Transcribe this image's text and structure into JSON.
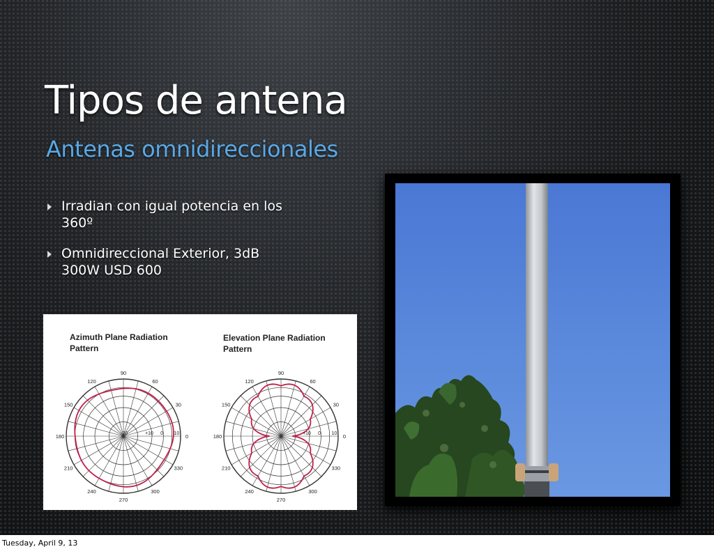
{
  "slide": {
    "title": "Tipos de antena",
    "subtitle": "Antenas omnidireccionales",
    "bullets": [
      {
        "line1": "Irradian con igual potencia en los",
        "line2": "360º"
      },
      {
        "line1": "Omnidireccional Exterior,  3dB",
        "line2": "300W USD 600"
      }
    ]
  },
  "patterns": {
    "azimuth": {
      "title_line1": "Azimuth Plane Radiation",
      "title_line2": "Pattern",
      "angle_labels": [
        "0",
        "30",
        "60",
        "90",
        "120",
        "150",
        "180",
        "210",
        "240",
        "270",
        "300",
        "330"
      ],
      "ring_labels": [
        "10",
        "0",
        "+10",
        "-20"
      ]
    },
    "elevation": {
      "title_line1": "Elevation Plane Radiation",
      "title_line2": "Pattern",
      "angle_labels": [
        "0",
        "30",
        "60",
        "90",
        "120",
        "150",
        "180",
        "210",
        "240",
        "270",
        "300",
        "330"
      ],
      "ring_labels": [
        "10",
        "0",
        "+10"
      ]
    },
    "curve_color": "#c0204a",
    "grid_color": "#333333"
  },
  "photo": {
    "subject": "omnidirectional-antenna-mast",
    "sky_color": "#4f7fd8",
    "mast_color": "#c9cdd0"
  },
  "footer": {
    "date": "Tuesday, April 9, 13"
  }
}
